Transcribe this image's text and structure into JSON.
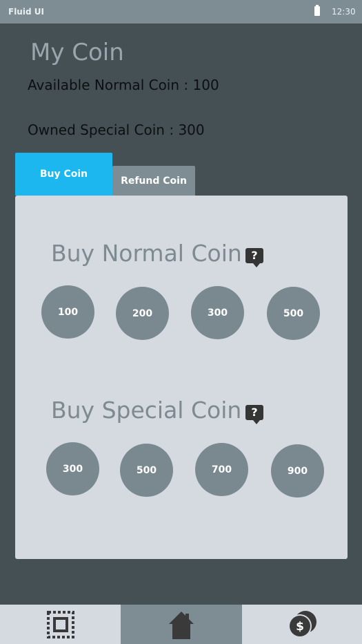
{
  "status_bar": {
    "app_name": "Fluid UI",
    "time": "12:30"
  },
  "page": {
    "title": "My Coin",
    "available_normal": "Available Normal Coin  : 100",
    "owned_special": "Owned Special Coin  : 300"
  },
  "tabs": {
    "buy": "Buy Coin",
    "refund": "Refund Coin"
  },
  "normal": {
    "title": "Buy Normal Coin",
    "help": "?",
    "options": [
      "100",
      "200",
      "300",
      "500"
    ]
  },
  "special": {
    "title": "Buy Special Coin",
    "help": "?",
    "options": [
      "300",
      "500",
      "700",
      "900"
    ]
  },
  "bottom_nav": {
    "items": [
      "select-frame-icon",
      "home-icon",
      "coins-dollar-icon"
    ]
  },
  "colors": {
    "accent": "#1cb7ef",
    "background": "#455055",
    "panel": "#d4dadf",
    "coin": "#7a8990"
  }
}
